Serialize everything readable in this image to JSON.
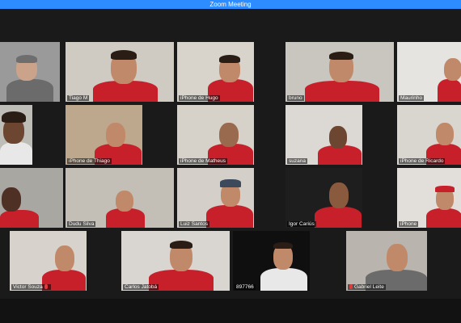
{
  "window": {
    "title": "Zoom Meeting"
  },
  "participants": {
    "r1": [
      "",
      "Tiago M",
      "iPhone de Hugo",
      "bruno",
      "Maurinho"
    ],
    "r2": [
      "",
      "iPhone de Thiago",
      "iPhone de Matheus",
      "suzana",
      "iPhone de Ricardo"
    ],
    "r3": [
      "",
      "Dudu Silva",
      "Luiz Santos",
      "Igor Cariús",
      "iPhone"
    ],
    "r4": [
      "Victor Souza",
      "Carlos Jatobá",
      "897766",
      "",
      "Gabriel Leite"
    ]
  },
  "colors": {
    "titlebar": "#2d8cff",
    "active_speaker": "#c7d83a",
    "shirt": "#c8202a"
  }
}
